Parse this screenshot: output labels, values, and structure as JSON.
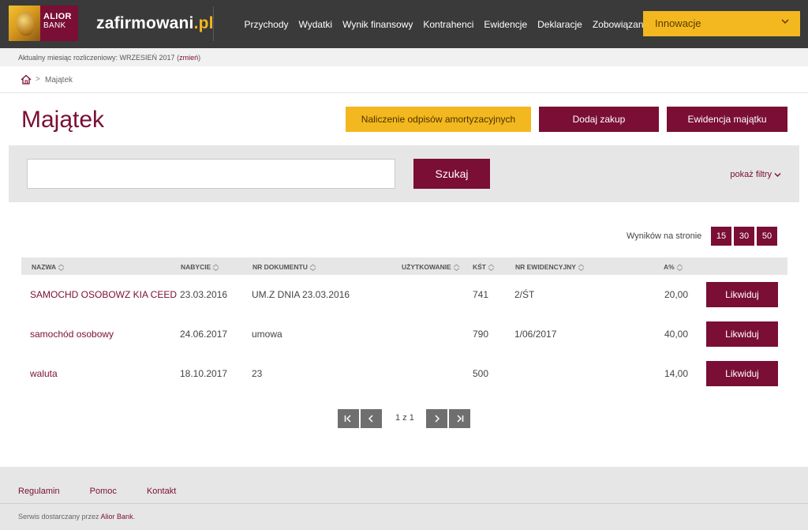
{
  "brand": {
    "logo_line1": "ALIOR",
    "logo_line2": "BANK",
    "site_name": "zafirmowani",
    "site_tld": ".pl"
  },
  "nav": {
    "items": [
      "Przychody",
      "Wydatki",
      "Wynik finansowy",
      "Kontrahenci",
      "Ewidencje",
      "Deklaracje",
      "Zobowiązania"
    ],
    "dropdown_label": "Innowacje"
  },
  "month_bar": {
    "text": "Aktualny miesiąc rozliczeniowy: WRZESIEŃ 2017 (",
    "link": "zmień",
    "close": ")"
  },
  "breadcrumb": {
    "current": "Majątek"
  },
  "page": {
    "title": "Majątek",
    "btn_amortization": "Naliczenie odpisów amortyzacyjnych",
    "btn_add": "Dodaj zakup",
    "btn_register": "Ewidencja majątku"
  },
  "search": {
    "value": "",
    "placeholder": "",
    "button": "Szukaj",
    "filters": "pokaż filtry"
  },
  "per_page": {
    "label": "Wyników na stronie",
    "options": [
      "15",
      "30",
      "50"
    ]
  },
  "table": {
    "headers": [
      "NAZWA",
      "NABYCIE",
      "NR DOKUMENTU",
      "UŻYTKOWANIE",
      "KŚT",
      "NR EWIDENCYJNY",
      "A%"
    ],
    "rows": [
      {
        "name": "SAMOCHD OSOBOWZ KIA CEED",
        "acquired": "23.03.2016",
        "doc": "UM.Z DNIA 23.03.2016",
        "usage": "",
        "kst": "741",
        "reg": "2/ŚT",
        "rate": "20,00",
        "action": "Likwiduj"
      },
      {
        "name": "samochód osobowy",
        "acquired": "24.06.2017",
        "doc": "umowa",
        "usage": "",
        "kst": "790",
        "reg": "1/06/2017",
        "rate": "40,00",
        "action": "Likwiduj"
      },
      {
        "name": "waluta",
        "acquired": "18.10.2017",
        "doc": "23",
        "usage": "",
        "kst": "500",
        "reg": "",
        "rate": "14,00",
        "action": "Likwiduj"
      }
    ]
  },
  "pagination": {
    "info": "1 z 1",
    "current_page": 1,
    "total_pages": 1
  },
  "footer": {
    "links": [
      "Regulamin",
      "Pomoc",
      "Kontakt"
    ],
    "note_prefix": "Serwis dostarczany przez ",
    "note_link": "Alior Bank",
    "note_suffix": "."
  },
  "colors": {
    "maroon": "#7a0e35",
    "yellow": "#f3b81f",
    "header_bg": "#3a3a3a",
    "panel_gray": "#e6e6e6"
  },
  "icons": [
    "home-icon",
    "chevron-down-icon",
    "sort-icon",
    "first-page-icon",
    "prev-page-icon",
    "next-page-icon",
    "last-page-icon"
  ]
}
